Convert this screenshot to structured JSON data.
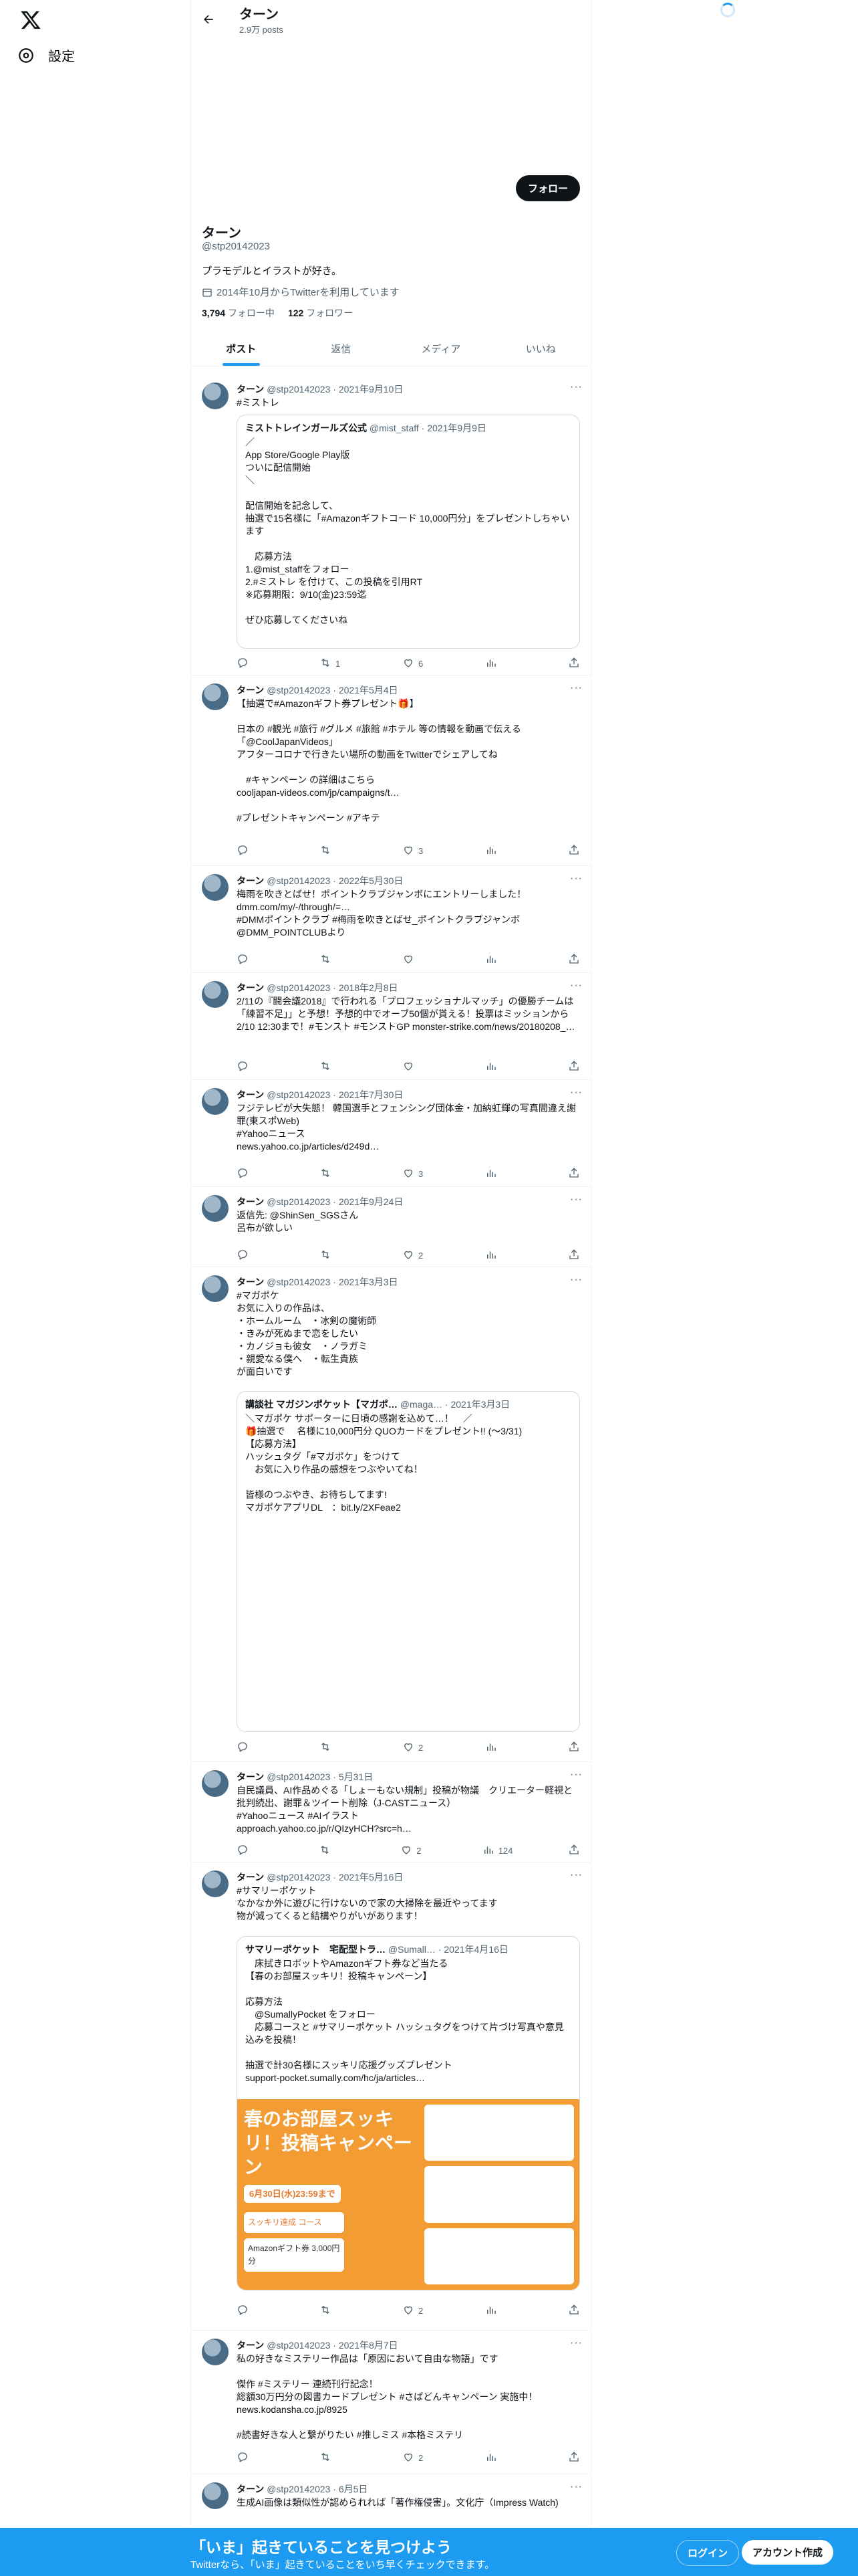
{
  "nav": {
    "settings_label": "設定"
  },
  "header": {
    "name": "ターン",
    "posts": "2.9万 posts"
  },
  "profile": {
    "follow_label": "フォロー",
    "name": "ターン",
    "handle": "@stp20142023",
    "bio": "プラモデルとイラストが好き。",
    "joined": "2014年10月からTwitterを利用しています",
    "following_count": "3,794",
    "following_label": "フォロー中",
    "followers_count": "122",
    "followers_label": "フォロワー"
  },
  "tabs": [
    "ポスト",
    "返信",
    "メディア",
    "いいね"
  ],
  "tweets": [
    {
      "name": "ターン",
      "handle": "@stp20142023",
      "date": "2021年9月10日",
      "text": "#ミストレ",
      "quote": {
        "name": "ミストトレインガールズ公式",
        "handle": "@mist_staff",
        "date": "2021年9月9日",
        "text": "／\nApp Store/Google Play版\nついに配信開始\n＼\n\n配信開始を記念して、\n抽選で15名様に「#Amazonギフトコード 10,000円分」をプレゼントしちゃいます\n\n　応募方法\n1.@mist_staffをフォロー\n2.#ミストレ を付けて、この投稿を引用RT\n※応募期限：9/10(金)23:59迄\n\nぜひ応募してくださいね"
      },
      "stats": {
        "reply": "",
        "retweet": "1",
        "like": "6",
        "views": ""
      }
    },
    {
      "name": "ターン",
      "handle": "@stp20142023",
      "date": "2021年5月4日",
      "text": "【抽選で#Amazonギフト券プレゼント🎁】\n\n日本の #観光 #旅行 #グルメ #旅館 #ホテル 等の情報を動画で伝える「@CoolJapanVideos」\nアフターコロナで行きたい場所の動画をTwitterでシェアしてね\n\n　#キャンペーン の詳細はこちら\ncooljapan-videos.com/jp/campaigns/t…\n\n#プレゼントキャンペーン #アキテ",
      "stats": {
        "reply": "",
        "retweet": "",
        "like": "3",
        "views": ""
      }
    },
    {
      "name": "ターン",
      "handle": "@stp20142023",
      "date": "2022年5月30日",
      "text": "梅雨を吹きとばせ！ポイントクラブジャンボにエントリーしました！\ndmm.com/my/-/through/=…\n#DMMポイントクラブ #梅雨を吹きとばせ_ポイントクラブジャンボ\n@DMM_POINTCLUBより",
      "stats": {
        "reply": "",
        "retweet": "",
        "like": "",
        "views": ""
      }
    },
    {
      "name": "ターン",
      "handle": "@stp20142023",
      "date": "2018年2月8日",
      "text": "2/11の『闘会議2018』で行われる「プロフェッショナルマッチ」の優勝チームは「練習不足」」と予想！予想的中でオーブ50個が貰える！投票はミッションから2/10 12:30まで！#モンスト #モンストGP monster-strike.com/news/20180208_…",
      "stats": {
        "reply": "",
        "retweet": "",
        "like": "",
        "views": ""
      }
    },
    {
      "name": "ターン",
      "handle": "@stp20142023",
      "date": "2021年7月30日",
      "text": "フジテレビが大失態！ 韓国選手とフェンシング団体金・加納虹輝の写真間違え謝罪(東スポWeb)\n#Yahooニュース\nnews.yahoo.co.jp/articles/d249d…",
      "stats": {
        "reply": "",
        "retweet": "",
        "like": "3",
        "views": ""
      }
    },
    {
      "name": "ターン",
      "handle": "@stp20142023",
      "date": "2021年9月24日",
      "text": "返信先: @ShinSen_SGSさん\n呂布が欲しい",
      "stats": {
        "reply": "",
        "retweet": "",
        "like": "2",
        "views": ""
      }
    },
    {
      "name": "ターン",
      "handle": "@stp20142023",
      "date": "2021年3月3日",
      "text": "#マガポケ\nお気に入りの作品は、\n・ホームルーム　・冰剣の魔術師\n・きみが死ぬまで恋をしたい\n・カノジョも彼女　・ノラガミ\n・親愛なる僕へ　・転生貴族\nが面白いです",
      "quote": {
        "name": "講談社 マガジンポケット【マガポ…",
        "handle": "@maga…",
        "date": "2021年3月3日",
        "text": "＼マガポケ サポーターに日頃の感謝を込めて…！　／\n🎁抽選で　 名様に10,000円分 QUOカードをプレゼント!! (〜3/31)\n【応募方法】\nハッシュタグ「#マガポケ」をつけて\n　お気に入り作品の感想をつぶやいてね！\n\n皆様のつぶやき、お待ちしてます!\nマガポケアプリDL　：bit.ly/2XFeae2"
      },
      "stats": {
        "reply": "",
        "retweet": "",
        "like": "2",
        "views": ""
      }
    },
    {
      "name": "ターン",
      "handle": "@stp20142023",
      "date": "5月31日",
      "text": "自民議員、AI作品めぐる「しょーもない規制」投稿が物議　クリエーター軽視と批判続出、謝罪＆ツイート削除（J-CASTニュース）\n#Yahooニュース #AIイラスト\napproach.yahoo.co.jp/r/QIzyHCH?src=h…",
      "stats": {
        "reply": "",
        "retweet": "",
        "like": "2",
        "views": "124"
      }
    },
    {
      "name": "ターン",
      "handle": "@stp20142023",
      "date": "2021年5月16日",
      "text": "#サマリーポケット\nなかなか外に遊びに行けないので家の大掃除を最近やってます\n物が減ってくると結構やりがいがあります！",
      "quote": {
        "name": "サマリーポケット　宅配型トラ…",
        "handle": "@Sumall…",
        "date": "2021年4月16日",
        "text": "　床拭きロボットやAmazonギフト券など当たる\n【春のお部屋スッキリ！投稿キャンペーン】\n\n応募方法\n　@SumallyPocket をフォロー\n　応募コースと #サマリーポケット ハッシュタグをつけて片づけ写真や意見込みを投稿！\n\n抽選で計30名様にスッキリ応援グッズプレゼント\nsupport-pocket.sumally.com/hc/ja/articles…"
      },
      "promo": {
        "title": "春のお部屋スッキリ！投稿キャンペーン",
        "deadline": "6月30日(水)23:59まで",
        "course": "スッキリ達成 コース",
        "prize": "Amazonギフト券 3,000円分"
      },
      "stats": {
        "reply": "",
        "retweet": "",
        "like": "2",
        "views": ""
      }
    },
    {
      "name": "ターン",
      "handle": "@stp20142023",
      "date": "2021年8月7日",
      "text": "私の好きなミステリー作品は「原因において自由な物語」です\n\n傑作 #ミステリー 連続刊行記念！\n総額30万円分の図書カードプレゼント #さばどんキャンペーン 実施中！\nnews.kodansha.co.jp/8925\n\n#読書好きな人と繋がりたい #推しミス #本格ミステリ",
      "stats": {
        "reply": "",
        "retweet": "",
        "like": "2",
        "views": ""
      }
    },
    {
      "name": "ターン",
      "handle": "@stp20142023",
      "date": "6月5日",
      "text": "生成AI画像は類似性が認められれば「著作権侵害」。文化庁（Impress Watch)",
      "stats": {
        "reply": "",
        "retweet": "",
        "like": "",
        "views": ""
      }
    }
  ],
  "bottombar": {
    "title": "「いま」起きていることを見つけよう",
    "subtitle": "Twitterなら、「いま」起きていることをいち早くチェックできます。",
    "login_label": "ログイン",
    "signup_label": "アカウント作成"
  }
}
